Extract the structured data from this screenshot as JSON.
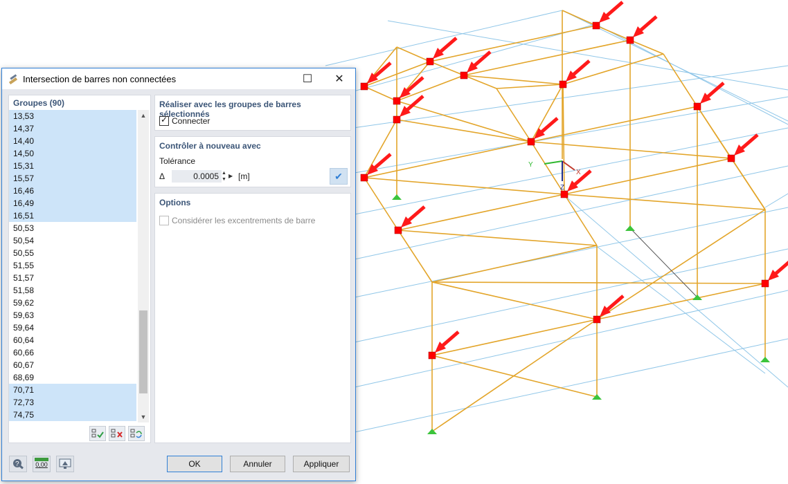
{
  "dialog": {
    "title": "Intersection de barres non connectées",
    "maximize_glyph": "☐",
    "close_glyph": "✕"
  },
  "groups": {
    "header": "Groupes (90)",
    "items": [
      {
        "label": "13,53",
        "selected": true
      },
      {
        "label": "14,37",
        "selected": true
      },
      {
        "label": "14,40",
        "selected": true
      },
      {
        "label": "14,50",
        "selected": true
      },
      {
        "label": "15,31",
        "selected": true
      },
      {
        "label": "15,57",
        "selected": true
      },
      {
        "label": "16,46",
        "selected": true
      },
      {
        "label": "16,49",
        "selected": true
      },
      {
        "label": "16,51",
        "selected": true
      },
      {
        "label": "50,53",
        "selected": false
      },
      {
        "label": "50,54",
        "selected": false
      },
      {
        "label": "50,55",
        "selected": false
      },
      {
        "label": "51,55",
        "selected": false
      },
      {
        "label": "51,57",
        "selected": false
      },
      {
        "label": "51,58",
        "selected": false
      },
      {
        "label": "59,62",
        "selected": false
      },
      {
        "label": "59,63",
        "selected": false
      },
      {
        "label": "59,64",
        "selected": false
      },
      {
        "label": "60,64",
        "selected": false
      },
      {
        "label": "60,66",
        "selected": false
      },
      {
        "label": "60,67",
        "selected": false
      },
      {
        "label": "68,69",
        "selected": false
      },
      {
        "label": "70,71",
        "selected": true
      },
      {
        "label": "72,73",
        "selected": true
      },
      {
        "label": "74,75",
        "selected": true
      }
    ],
    "tools": [
      "select-all-icon",
      "deselect-all-icon",
      "invert-selection-icon"
    ]
  },
  "realize": {
    "title": "Réaliser avec les groupes de barres sélectionnés",
    "connect_label": "Connecter",
    "connect_checked": true
  },
  "recheck": {
    "title": "Contrôler à nouveau avec",
    "tolerance_label": "Tolérance",
    "delta_symbol": "Δ",
    "tolerance_value": "0.0005",
    "unit": "[m]"
  },
  "options": {
    "title": "Options",
    "eccentricity_label": "Considérer les excentrements de barre",
    "eccentricity_checked": false
  },
  "buttons": {
    "ok": "OK",
    "cancel": "Annuler",
    "apply": "Appliquer"
  },
  "bottom_icons": [
    "help-icon",
    "units-icon",
    "view-icon"
  ],
  "units_icon_text": "0,00",
  "axes": {
    "x": "X",
    "y": "Y",
    "z": "Z"
  },
  "colors": {
    "accent": "#2f7fd6",
    "member": "#e3a52a",
    "grid_line": "#8fc6e8",
    "node_marker": "#ff0000",
    "arrow": "#ff1a1a",
    "support": "#3cc43c",
    "selected_row": "#cde4f9"
  }
}
